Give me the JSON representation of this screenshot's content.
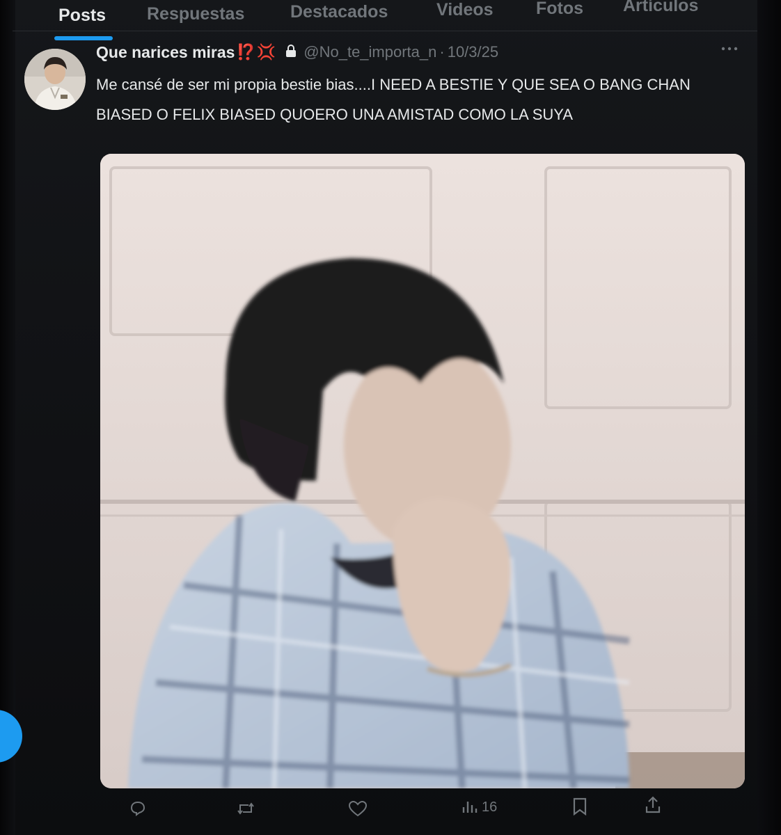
{
  "tabs": [
    {
      "label": "Posts",
      "active": true
    },
    {
      "label": "Respuestas",
      "active": false
    },
    {
      "label": "Destacados",
      "active": false
    },
    {
      "label": "Videos",
      "active": false
    },
    {
      "label": "Fotos",
      "active": false
    },
    {
      "label": "Artículos",
      "active": false
    }
  ],
  "post": {
    "display_name": "Que narices miras",
    "name_emoji_1": "⁉️",
    "name_emoji_2": "💢",
    "handle": "@No_te_importa_n",
    "separator": "·",
    "date": "10/3/25",
    "more_icon": "more-dots-icon",
    "text": "Me cansé de ser mi propia bestie bias....I NEED A BESTIE Y QUE SEA O BANG CHAN BIASED O FELIX BIASED QUOERO UNA AMISTAD COMO LA SUYA",
    "actions": {
      "reply_icon": "reply-icon",
      "repost_icon": "repost-icon",
      "like_icon": "heart-icon",
      "views_icon": "views-chart-icon",
      "views_count": "16",
      "bookmark_icon": "bookmark-icon",
      "share_icon": "share-icon"
    }
  },
  "colors": {
    "accent": "#1d9bf0",
    "background": "#101114",
    "text_primary": "#e7e9ea",
    "text_secondary": "#71767b",
    "angry_emoji": "#e0245e"
  }
}
